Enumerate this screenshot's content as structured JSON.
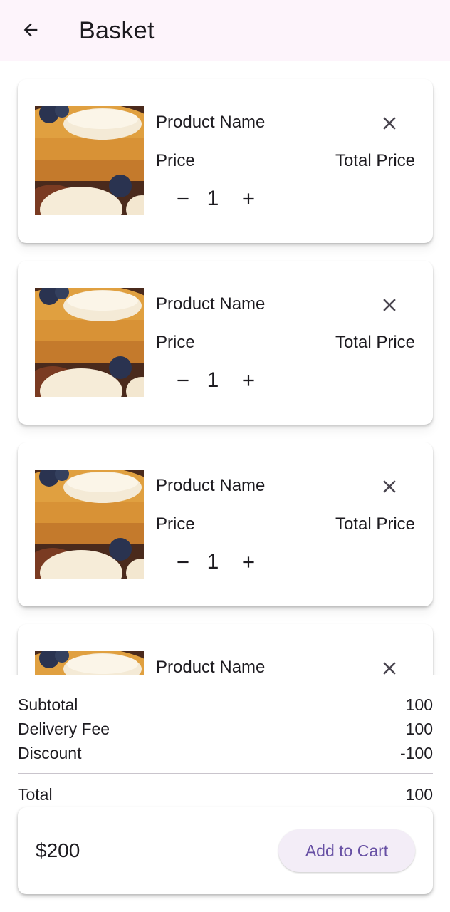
{
  "appbar": {
    "title": "Basket",
    "back_icon": "arrow-left-icon"
  },
  "items": [
    {
      "name": "Product Name",
      "price": "Price",
      "total": "Total Price",
      "quantity": "1"
    },
    {
      "name": "Product Name",
      "price": "Price",
      "total": "Total Price",
      "quantity": "1"
    },
    {
      "name": "Product Name",
      "price": "Price",
      "total": "Total Price",
      "quantity": "1"
    },
    {
      "name": "Product Name"
    }
  ],
  "summary": {
    "subtotal_label": "Subtotal",
    "subtotal": "100",
    "delivery_label": "Delivery Fee",
    "delivery": "100",
    "discount_label": "Discount",
    "discount": "-100",
    "total_label": "Total",
    "total": "100"
  },
  "footer": {
    "amount": "$200",
    "button_label": "Add to Cart"
  },
  "colors": {
    "appbar_bg": "#fdf4fb",
    "accent": "#6750a4",
    "button_bg": "#f3edf7"
  }
}
